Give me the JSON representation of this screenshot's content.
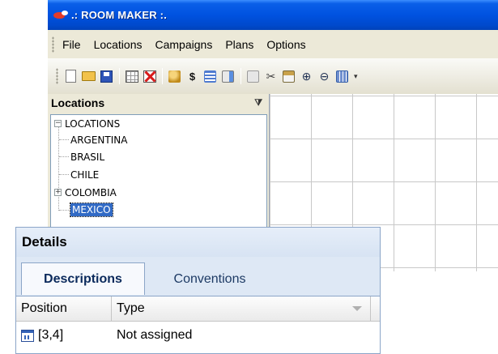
{
  "window": {
    "title": ".: ROOM MAKER :.",
    "app_icon": "app-logo-icon"
  },
  "menu": {
    "items": [
      "File",
      "Locations",
      "Campaigns",
      "Plans",
      "Options"
    ]
  },
  "toolbar": {
    "icons": [
      "new-icon",
      "open-folder-icon",
      "save-icon",
      "grid-icon",
      "delete-grid-icon",
      "users-icon",
      "currency-icon",
      "list-icon",
      "export-icon",
      "edit-icon",
      "cut-icon",
      "paste-icon",
      "zoom-in-icon",
      "zoom-out-icon",
      "calculator-icon",
      "toolbar-overflow-icon"
    ]
  },
  "locations": {
    "title": "Locations",
    "pin_icon": "pin-icon",
    "root": "LOCATIONS",
    "root_expander": "−",
    "items": [
      {
        "label": "ARGENTINA",
        "expander": ""
      },
      {
        "label": "BRASIL",
        "expander": ""
      },
      {
        "label": "CHILE",
        "expander": ""
      },
      {
        "label": "COLOMBIA",
        "expander": "+"
      },
      {
        "label": "MEXICO",
        "expander": "",
        "selected": true
      }
    ]
  },
  "details": {
    "title": "Details",
    "tabs": [
      {
        "label": "Descriptions",
        "active": true
      },
      {
        "label": "Conventions",
        "active": false
      }
    ],
    "columns": [
      "Position",
      "Type"
    ],
    "rows": [
      {
        "position": "[3,4]",
        "type": "Not assigned",
        "icon": "table-cell-icon"
      }
    ]
  },
  "colors": {
    "title_bar": "#0052e0",
    "selection": "#316ac5",
    "details_background": "#dee8f5"
  }
}
